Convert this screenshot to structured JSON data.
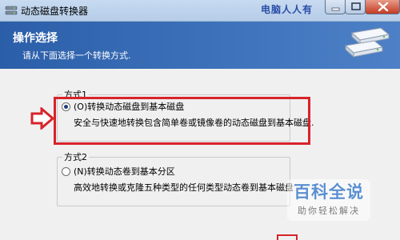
{
  "window": {
    "title": "动态磁盘转换器",
    "watermark": "电脑人人有",
    "icons": {
      "app": "disk-app-icon",
      "minimize": "minimize-icon",
      "maximize": "maximize-icon",
      "close": "close-icon"
    }
  },
  "header": {
    "title": "操作选择",
    "subtitle": "请从下面选择一个转换方式.",
    "icon": "disk-drives-icon"
  },
  "options": [
    {
      "group_label": "方式1",
      "label": "(O)转换动态磁盘到基本磁盘",
      "description": "安全与快速地转换包含简单卷或镜像卷的动态磁盘到基本磁盘.",
      "selected": true
    },
    {
      "group_label": "方式2",
      "label": "(N)转换动态卷到基本分区",
      "description": "高效地转换或克隆五种类型的任何类型动态卷到基本磁盘",
      "selected": false
    }
  ],
  "annotation": {
    "icon": "right-arrow-icon",
    "color": "#d8232a"
  },
  "baike": {
    "title": "百科全说",
    "subtitle": "助你轻松解决",
    "icon": "baike-logo"
  },
  "colors": {
    "header_start": "#2b5ea8",
    "header_end": "#4d80c6",
    "highlight": "#d8232a",
    "watermark": "#2b4fa8"
  }
}
